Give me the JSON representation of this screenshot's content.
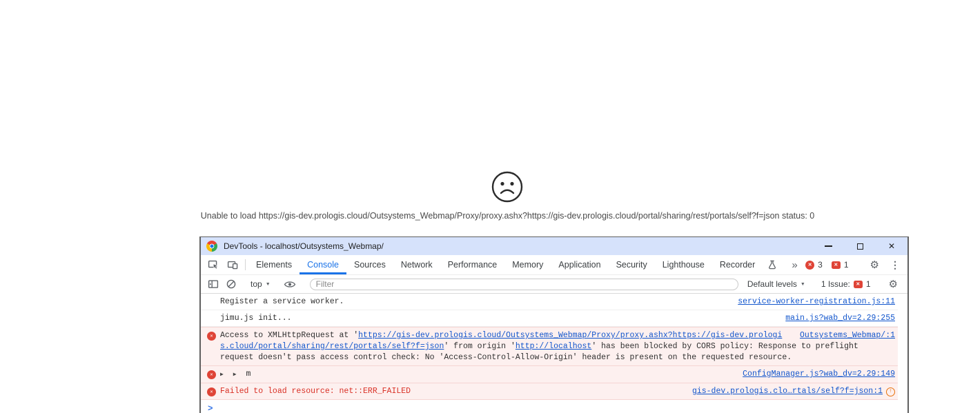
{
  "page": {
    "load_error": "Unable to load https://gis-dev.prologis.cloud/Outsystems_Webmap/Proxy/proxy.ashx?https://gis-dev.prologis.cloud/portal/sharing/rest/portals/self?f=json status: 0"
  },
  "devtools": {
    "title": "DevTools - localhost/Outsystems_Webmap/",
    "tabs": [
      "Elements",
      "Console",
      "Sources",
      "Network",
      "Performance",
      "Memory",
      "Application",
      "Security",
      "Lighthouse",
      "Recorder"
    ],
    "active_tab": "Console",
    "badges": {
      "errors": "3",
      "issues": "1"
    },
    "toolbar": {
      "context": "top",
      "filter_placeholder": "Filter",
      "levels": "Default levels",
      "issue_label": "1 Issue:",
      "issue_count": "1"
    },
    "console": {
      "msg_sw": {
        "text": "Register a service worker.",
        "source": "service-worker-registration.js:11"
      },
      "msg_jimu": {
        "text": "jimu.js init...",
        "source": "main.js?wab_dv=2.29:255"
      },
      "msg_cors": {
        "prefix": "Access to XMLHttpRequest at '",
        "url1": "https://gis-dev.prologis.cloud/Outsystems_Webmap/Proxy/proxy.ashx?https://gis-dev.prologis.cloud/portal/sharing/rest/portals/self?f=json",
        "mid": "' from origin '",
        "url2": "http://localhost",
        "suffix": "' has been blocked by CORS policy: Response to preflight request doesn't pass access control check: No 'Access-Control-Allow-Origin' header is present on the requested resource.",
        "source": "Outsystems_Webmap/:1"
      },
      "msg_obj": {
        "object_preview": "m",
        "source": "ConfigManager.js?wab_dv=2.29:149"
      },
      "msg_failed": {
        "text": "Failed to load resource: net::ERR_FAILED",
        "source": "gis-dev.prologis.clo…rtals/self?f=json:1"
      }
    }
  },
  "icons": {
    "close": "✕",
    "more_tabs": "»",
    "gear": "⚙",
    "kebab": "⋮",
    "dropdown_arrow": "▼",
    "expand_arrow": "▶",
    "badge_x": "✕",
    "prompt_chevron": ">",
    "arrow_up": "↑"
  },
  "colors": {
    "titlebar_bg": "#d6e2fb",
    "accent_blue": "#1a73e8",
    "link_blue": "#1155cc",
    "error_red": "#d93025",
    "badge_red": "#df4437",
    "error_row_bg": "#fdf0ef",
    "error_row_border": "#f5d4d2",
    "network_icon_orange": "#e8710a"
  }
}
